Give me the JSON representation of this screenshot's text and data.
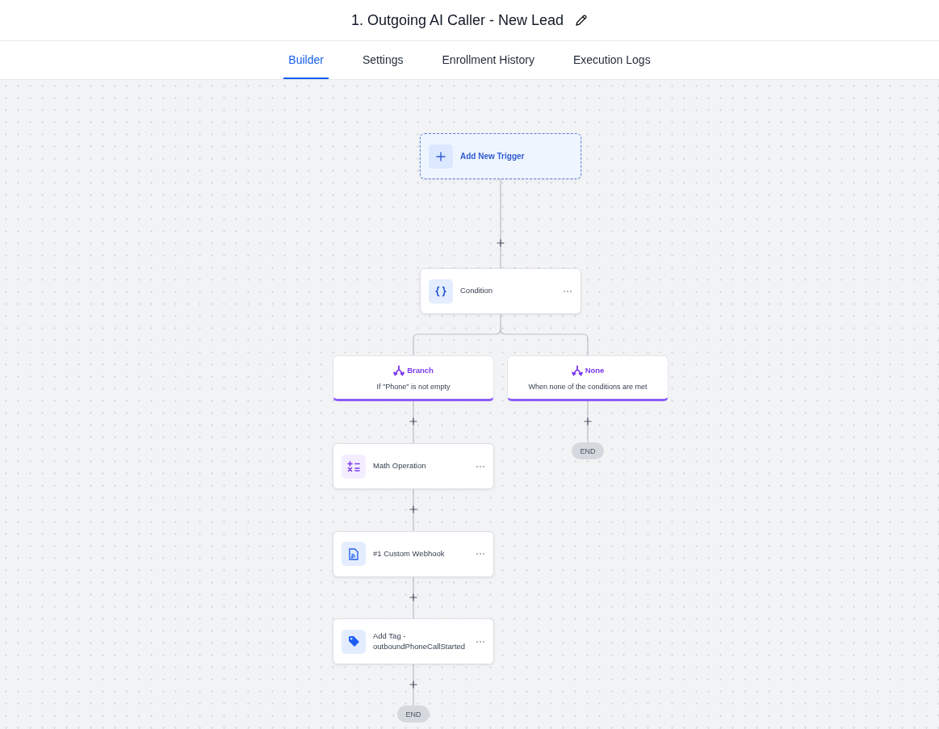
{
  "title": "1. Outgoing AI Caller - New Lead",
  "tabs": [
    {
      "label": "Builder",
      "selected": true
    },
    {
      "label": "Settings",
      "selected": false
    },
    {
      "label": "Enrollment History",
      "selected": false
    },
    {
      "label": "Execution Logs",
      "selected": false
    }
  ],
  "trigger": {
    "label": "Add New Trigger"
  },
  "condition": {
    "label": "Condition"
  },
  "branches": [
    {
      "title": "Branch",
      "description": "If \"Phone\" is not empty",
      "end": "END",
      "steps": [
        {
          "kind": "math",
          "label": "Math Operation"
        },
        {
          "kind": "webhook",
          "label": "#1 Custom Webhook"
        },
        {
          "kind": "tag",
          "label": "Add Tag - outboundPhoneCallStarted"
        }
      ]
    },
    {
      "title": "None",
      "description": "When none of the conditions are met",
      "end": "END"
    }
  ]
}
